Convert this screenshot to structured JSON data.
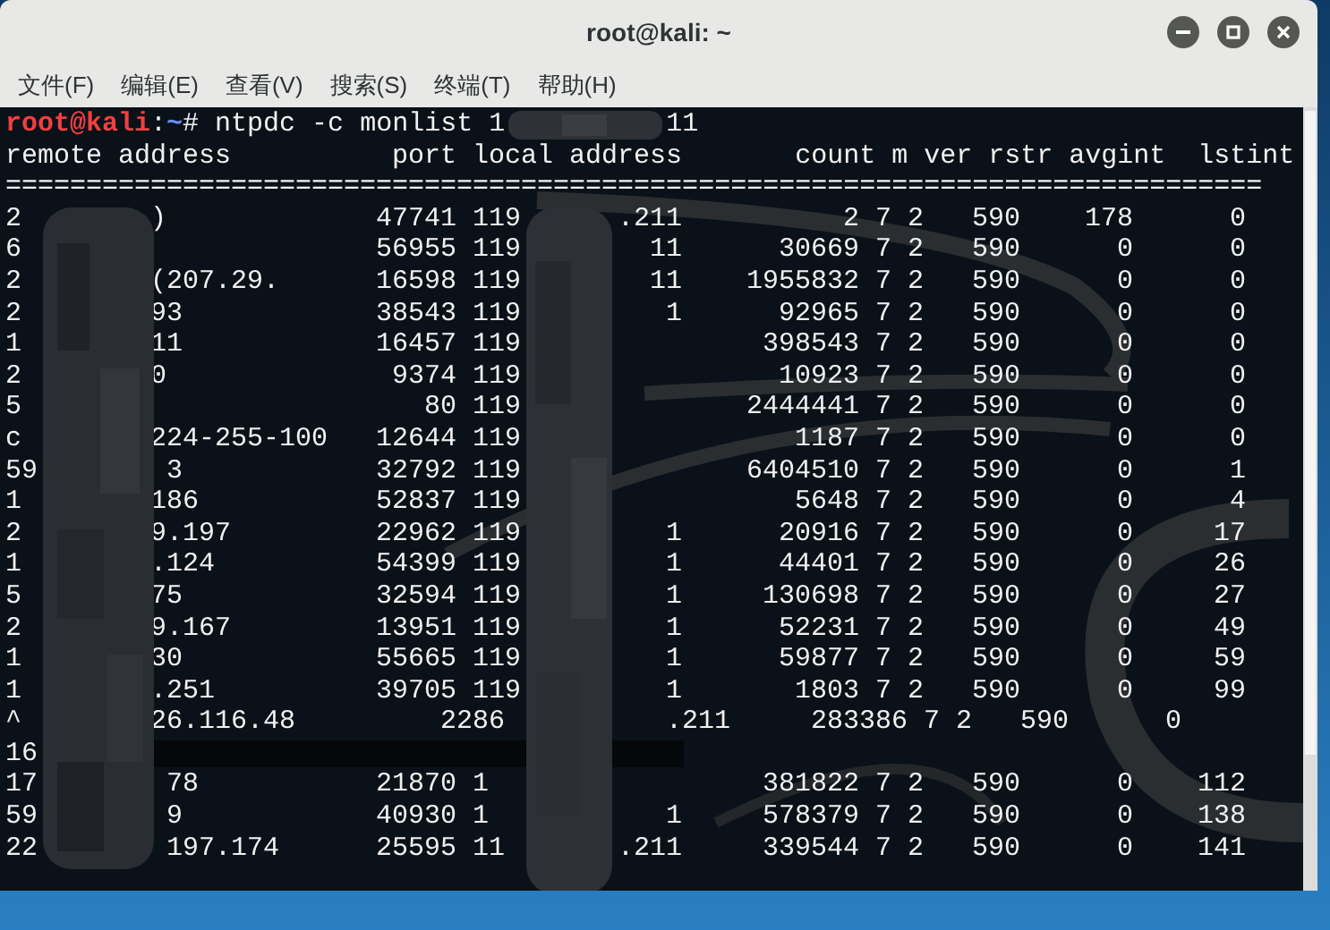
{
  "window": {
    "title": "root@kali: ~"
  },
  "menu": [
    "文件(F)",
    "编辑(E)",
    "查看(V)",
    "搜索(S)",
    "终端(T)",
    "帮助(H)"
  ],
  "terminal": {
    "prompt": {
      "user_host": "root@kali",
      "colon": ":",
      "path": "~",
      "symbol": "#",
      "command": "ntpdc -c monlist 1",
      "command_tail": "11"
    },
    "header": "remote address          port local address       count m ver rstr avgint  lstint",
    "separator": "==============================================================================",
    "rows": [
      {
        "kind": "entry",
        "remote_start": "2",
        "remote_end": ")",
        "port": "47741",
        "local_start": "119",
        "local_end": ".211",
        "count": "2",
        "m": "7",
        "ver": "2",
        "rstr": "590",
        "avgint": "178",
        "lstint": "0"
      },
      {
        "kind": "entry",
        "remote_start": "6",
        "port": "56955",
        "local_start": "119",
        "local_end": "11",
        "count": "30669",
        "m": "7",
        "ver": "2",
        "rstr": "590",
        "avgint": "0",
        "lstint": "0"
      },
      {
        "kind": "entry",
        "remote_start": "2",
        "remote_end": "(207.29.",
        "port": "16598",
        "local_start": "119",
        "local_end": "11",
        "count": "1955832",
        "m": "7",
        "ver": "2",
        "rstr": "590",
        "avgint": "0",
        "lstint": "0"
      },
      {
        "kind": "entry",
        "remote_start": "2",
        "remote_end": "93",
        "port": "38543",
        "local_start": "119",
        "local_end": "1",
        "count": "92965",
        "m": "7",
        "ver": "2",
        "rstr": "590",
        "avgint": "0",
        "lstint": "0"
      },
      {
        "kind": "entry",
        "remote_start": "1",
        "remote_end": "11",
        "port": "16457",
        "local_start": "119",
        "count": "398543",
        "m": "7",
        "ver": "2",
        "rstr": "590",
        "avgint": "0",
        "lstint": "0"
      },
      {
        "kind": "entry",
        "remote_start": "2",
        "remote_end": "0",
        "port": "9374",
        "local_start": "119",
        "count": "10923",
        "m": "7",
        "ver": "2",
        "rstr": "590",
        "avgint": "0",
        "lstint": "0"
      },
      {
        "kind": "entry",
        "remote_start": "5",
        "port": "80",
        "local_start": "119",
        "count": "2444441",
        "m": "7",
        "ver": "2",
        "rstr": "590",
        "avgint": "0",
        "lstint": "0"
      },
      {
        "kind": "entry",
        "remote_start": "c",
        "remote_end": "224-255-100",
        "port": "12644",
        "local_start": "119",
        "count": "1187",
        "m": "7",
        "ver": "2",
        "rstr": "590",
        "avgint": "0",
        "lstint": "0"
      },
      {
        "kind": "entry",
        "remote_start": "59",
        "remote_end": "3",
        "port": "32792",
        "local_start": "119",
        "count": "6404510",
        "m": "7",
        "ver": "2",
        "rstr": "590",
        "avgint": "0",
        "lstint": "1"
      },
      {
        "kind": "entry",
        "remote_start": "1",
        "remote_end": "186",
        "port": "52837",
        "local_start": "119",
        "count": "5648",
        "m": "7",
        "ver": "2",
        "rstr": "590",
        "avgint": "0",
        "lstint": "4"
      },
      {
        "kind": "entry",
        "remote_start": "2",
        "remote_end": "9.197",
        "port": "22962",
        "local_start": "119",
        "local_end": "1",
        "count": "20916",
        "m": "7",
        "ver": "2",
        "rstr": "590",
        "avgint": "0",
        "lstint": "17"
      },
      {
        "kind": "entry",
        "remote_start": "1",
        "remote_end": ".124",
        "port": "54399",
        "local_start": "119",
        "local_end": "1",
        "count": "44401",
        "m": "7",
        "ver": "2",
        "rstr": "590",
        "avgint": "0",
        "lstint": "26"
      },
      {
        "kind": "entry",
        "remote_start": "5",
        "remote_end": "75",
        "port": "32594",
        "local_start": "119",
        "local_end": "1",
        "count": "130698",
        "m": "7",
        "ver": "2",
        "rstr": "590",
        "avgint": "0",
        "lstint": "27"
      },
      {
        "kind": "entry",
        "remote_start": "2",
        "remote_end": "9.167",
        "port": "13951",
        "local_start": "119",
        "local_end": "1",
        "count": "52231",
        "m": "7",
        "ver": "2",
        "rstr": "590",
        "avgint": "0",
        "lstint": "49"
      },
      {
        "kind": "entry",
        "remote_start": "1",
        "remote_end": "30",
        "port": "55665",
        "local_start": "119",
        "local_end": "1",
        "count": "59877",
        "m": "7",
        "ver": "2",
        "rstr": "590",
        "avgint": "0",
        "lstint": "59"
      },
      {
        "kind": "entry",
        "remote_start": "1",
        "remote_end": ".251",
        "port": "39705",
        "local_start": "119",
        "local_end": "1",
        "count": "1803",
        "m": "7",
        "ver": "2",
        "rstr": "590",
        "avgint": "0",
        "lstint": "99"
      },
      {
        "kind": "wrapped",
        "remote_start": "^",
        "remote_end": "26.116.48",
        "port": "2286",
        "local_end": ".211",
        "count": "283386",
        "m": "7",
        "ver": "2",
        "rstr": "590",
        "avgint": "0"
      },
      {
        "kind": "continuation",
        "remote_start": "16"
      },
      {
        "kind": "entry",
        "remote_start": "17",
        "remote_end": "78",
        "port": "21870",
        "local_start": "1",
        "count": "381822",
        "m": "7",
        "ver": "2",
        "rstr": "590",
        "avgint": "0",
        "lstint": "112"
      },
      {
        "kind": "entry",
        "remote_start": "59",
        "remote_end": "9",
        "port": "40930",
        "local_start": "1",
        "local_end": "1",
        "count": "578379",
        "m": "7",
        "ver": "2",
        "rstr": "590",
        "avgint": "0",
        "lstint": "138"
      },
      {
        "kind": "entry",
        "remote_start": "22",
        "remote_end": "197.174",
        "port": "25595",
        "local_start": "11",
        "local_end": ".211",
        "count": "339544",
        "m": "7",
        "ver": "2",
        "rstr": "590",
        "avgint": "0",
        "lstint": "141"
      }
    ]
  }
}
